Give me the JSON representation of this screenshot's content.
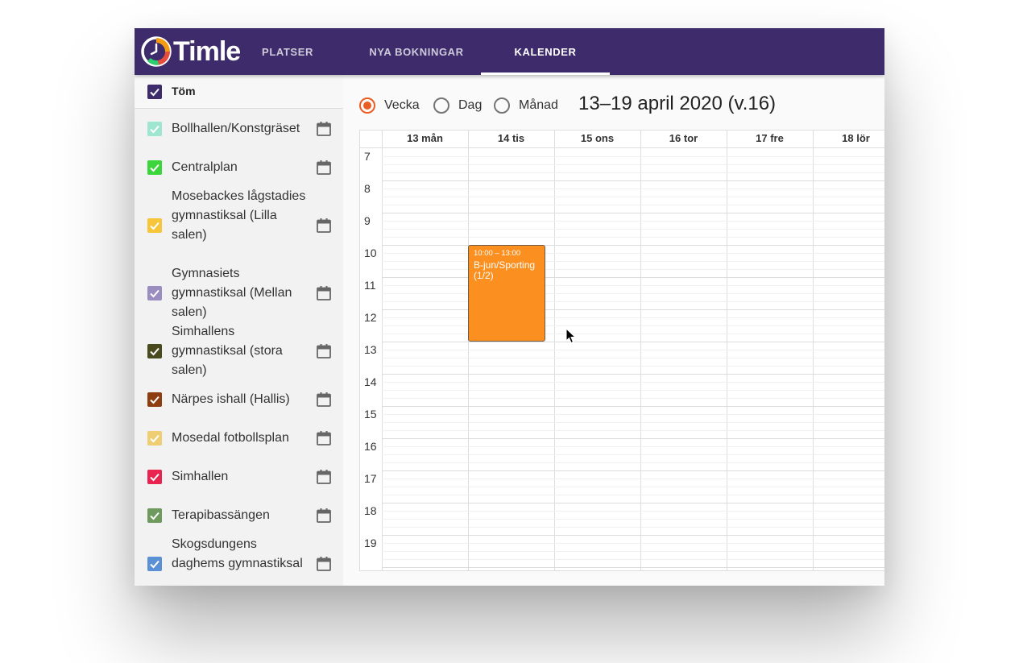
{
  "header": {
    "logo_text": "Timle",
    "tabs": [
      {
        "label": "PLATSER"
      },
      {
        "label": "NYA BOKNINGAR"
      },
      {
        "label": "KALENDER"
      }
    ],
    "brand_color": "#3d2b6b"
  },
  "sidebar": {
    "clear_label": "Töm",
    "places": [
      {
        "label": "Bollhallen/Konstgräset",
        "color": "#9ee6cf"
      },
      {
        "label": "Centralplan",
        "color": "#3cd63c"
      },
      {
        "label": "Mosebackes lågstadies gymnastiksal (Lilla salen)",
        "color": "#f7c53a"
      },
      {
        "label": "Gymnasiets gymnastiksal (Mellan salen)",
        "color": "#9a8ec0"
      },
      {
        "label": "Simhallens gymnastiksal (stora salen)",
        "color": "#4a4a1f"
      },
      {
        "label": "Närpes ishall (Hallis)",
        "color": "#8e3d10"
      },
      {
        "label": "Mosedal fotbollsplan",
        "color": "#efcd73"
      },
      {
        "label": "Simhallen",
        "color": "#e8234f"
      },
      {
        "label": "Terapibassängen",
        "color": "#6f9a5e"
      },
      {
        "label": "Skogsdungens daghems gymnastiksal",
        "color": "#5b8fd6"
      }
    ]
  },
  "view_options": [
    {
      "label": "Vecka",
      "selected": true
    },
    {
      "label": "Dag",
      "selected": false
    },
    {
      "label": "Månad",
      "selected": false
    }
  ],
  "range_title": "13–19 april 2020 (v.16)",
  "calendar": {
    "days": [
      "13 mån",
      "14 tis",
      "15 ons",
      "16 tor",
      "17 fre",
      "18 lör"
    ],
    "hours": [
      "7",
      "8",
      "9",
      "10",
      "11",
      "12",
      "13",
      "14",
      "15",
      "16",
      "17",
      "18",
      "19"
    ],
    "event": {
      "time": "10:00 – 13:00",
      "title": "B-jun/Sporting (1/2)",
      "color": "#fb8f1f"
    }
  }
}
